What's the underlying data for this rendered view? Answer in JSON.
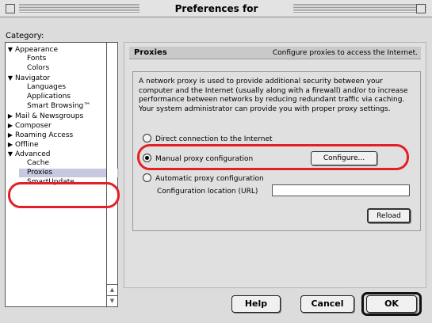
{
  "window": {
    "title": "Preferences for"
  },
  "sidebar": {
    "label": "Category:",
    "items": [
      {
        "label": "Appearance",
        "expanded": true,
        "level": 0
      },
      {
        "label": "Fonts",
        "level": 1
      },
      {
        "label": "Colors",
        "level": 1
      },
      {
        "label": "Navigator",
        "expanded": true,
        "level": 0
      },
      {
        "label": "Languages",
        "level": 1
      },
      {
        "label": "Applications",
        "level": 1
      },
      {
        "label": "Smart Browsing™",
        "level": 1
      },
      {
        "label": "Mail & Newsgroups",
        "expanded": false,
        "level": 0
      },
      {
        "label": "Composer",
        "expanded": false,
        "level": 0
      },
      {
        "label": "Roaming Access",
        "expanded": false,
        "level": 0
      },
      {
        "label": "Offline",
        "expanded": false,
        "level": 0
      },
      {
        "label": "Advanced",
        "expanded": true,
        "level": 0
      },
      {
        "label": "Cache",
        "level": 1
      },
      {
        "label": "Proxies",
        "level": 1,
        "selected": true
      },
      {
        "label": "SmartUpdate",
        "level": 1
      }
    ]
  },
  "panel": {
    "title": "Proxies",
    "description": "Configure proxies to access the Internet.",
    "intro": "A network proxy is used to provide additional security between your computer and the Internet (usually along with a firewall) and/or to increase performance between networks by reducing redundant traffic via caching. Your system administrator can provide you with proper proxy settings.",
    "options": {
      "direct": "Direct connection to the Internet",
      "manual": "Manual proxy configuration",
      "automatic": "Automatic proxy configuration"
    },
    "selected_option": "manual",
    "configure_label": "Configure...",
    "location_label": "Configuration location (URL)",
    "location_value": "",
    "reload_label": "Reload"
  },
  "footer": {
    "help_label": "Help",
    "cancel_label": "Cancel",
    "ok_label": "OK"
  },
  "annotation_color": "#e51f26"
}
